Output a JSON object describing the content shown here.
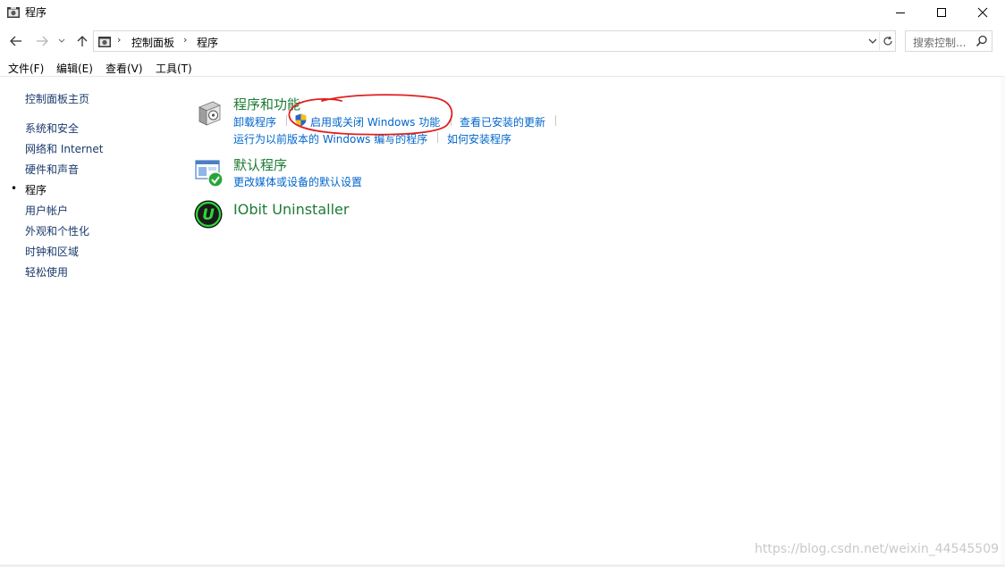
{
  "window": {
    "title": "程序"
  },
  "address": {
    "crumbs": [
      "控制面板",
      "程序"
    ]
  },
  "search": {
    "placeholder": "搜索控制..."
  },
  "menu": [
    "文件(F)",
    "编辑(E)",
    "查看(V)",
    "工具(T)"
  ],
  "leftnav": {
    "home": "控制面板主页",
    "items": [
      "系统和安全",
      "网络和 Internet",
      "硬件和声音",
      "程序",
      "用户帐户",
      "外观和个性化",
      "时钟和区域",
      "轻松使用"
    ],
    "active_index": 3,
    "bullet": "•"
  },
  "categories": [
    {
      "title": "程序和功能",
      "icon": "programs-features-icon",
      "links_row1": [
        "卸载程序",
        "启用或关闭 Windows 功能",
        "查看已安装的更新"
      ],
      "links_row2": [
        "运行为以前版本的 Windows 编写的程序",
        "如何安装程序"
      ]
    },
    {
      "title": "默认程序",
      "icon": "default-programs-icon",
      "links_row1": [
        "更改媒体或设备的默认设置"
      ]
    },
    {
      "title": "IObit Uninstaller",
      "icon": "iobit-uninstaller-icon",
      "icon_letter": "U"
    }
  ],
  "watermark": "https://blog.csdn.net/weixin_44545509",
  "colors": {
    "category_title": "#1e7b34",
    "link": "#0066cc",
    "annotation": "#e02020"
  }
}
